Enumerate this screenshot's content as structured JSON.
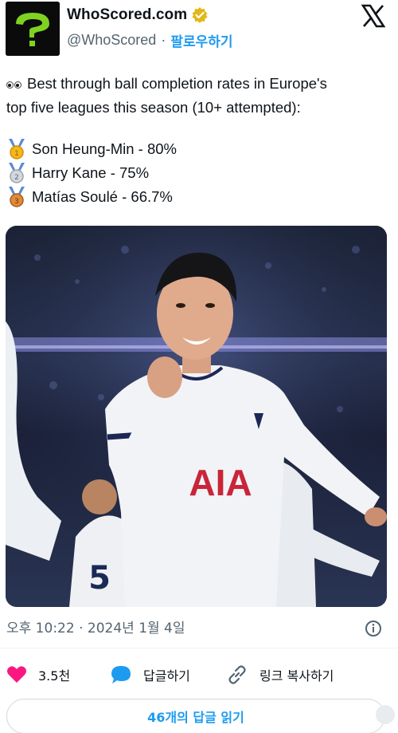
{
  "account": {
    "name": "WhoScored.com",
    "handle": "@WhoScored",
    "separator": "·",
    "follow_label": "팔로우하기"
  },
  "tweet": {
    "line1": "Best through ball completion rates in Europe's",
    "line2": "top five leagues this season (10+ attempted):",
    "rankings": [
      {
        "text": "Son Heung-Min - 80%",
        "medal": "gold-medal-icon"
      },
      {
        "text": "Harry Kane - 75%",
        "medal": "silver-medal-icon"
      },
      {
        "text": "Matías Soulé - 66.7%",
        "medal": "bronze-medal-icon"
      }
    ]
  },
  "photo": {
    "jersey_sponsor": "AIA",
    "jersey_number": "5"
  },
  "timestamp": "오후 10:22 · 2024년 1월 4일",
  "actions": {
    "likes_count": "3.5천",
    "reply_label": "답글하기",
    "copy_link_label": "링크 복사하기"
  },
  "read_replies_label": "46개의 답글 읽기",
  "colors": {
    "accent": "#1d9bf0",
    "like": "#f91880",
    "secondary_text": "#536471",
    "avatar_mark": "#7ed321",
    "verified_badge": "#e2b719"
  },
  "icons": [
    "whoscored-logo-icon",
    "verified-badge-icon",
    "x-logo-icon",
    "eyes-icon",
    "info-icon",
    "heart-icon",
    "reply-bubble-icon",
    "link-icon"
  ]
}
